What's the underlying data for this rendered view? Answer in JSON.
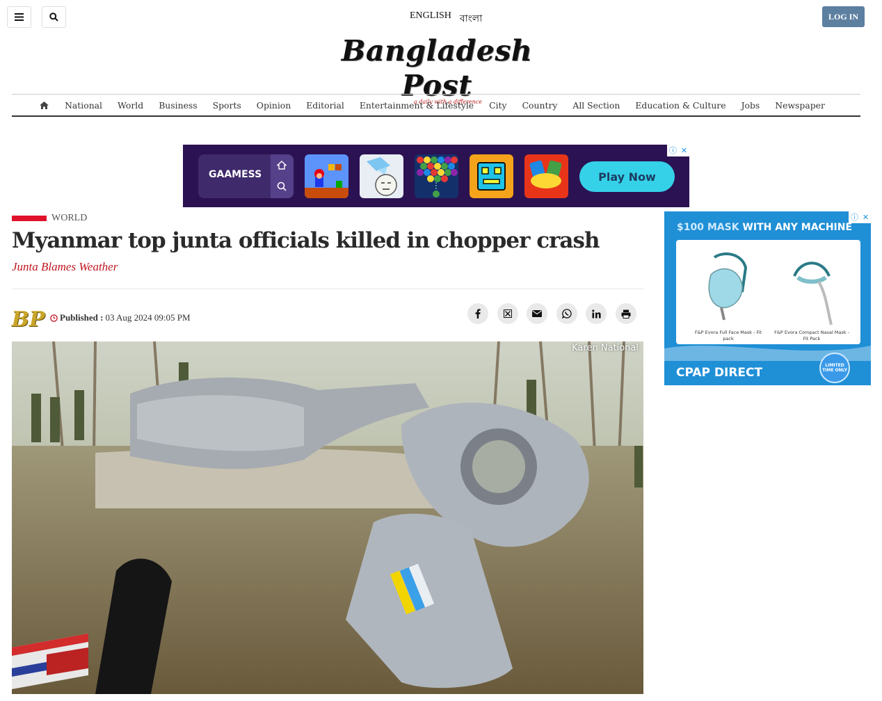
{
  "header": {
    "lang_english": "ENGLISH",
    "lang_bangla": "বাংলা",
    "login_label": "LOG IN",
    "logo_text": "Bangladesh Post",
    "logo_tagline": "a daily with a difference"
  },
  "nav": {
    "items": [
      "National",
      "World",
      "Business",
      "Sports",
      "Opinion",
      "Editorial",
      "Entertainment & Lifestyle",
      "City",
      "Country",
      "All Section",
      "Education & Culture",
      "Jobs",
      "Newspaper"
    ]
  },
  "ad_top": {
    "brand": "GAAMESS",
    "cta": "Play Now",
    "games": [
      "mario-game",
      "ice-face-game",
      "bubble-shooter-game",
      "geometry-dash-game",
      "uno-game"
    ]
  },
  "article": {
    "category": "WORLD",
    "title": "Myanmar top junta officials killed in chopper crash",
    "subtitle": "Junta Blames Weather",
    "published_label": "Published :",
    "published_date": "03 Aug 2024 09:05 PM",
    "author_logo": "BP",
    "image_credit": "Karen National"
  },
  "share_icons": [
    "facebook-icon",
    "x-icon",
    "email-icon",
    "whatsapp-icon",
    "linkedin-icon",
    "print-icon"
  ],
  "ad_side": {
    "headline_accent": "$100 MASK",
    "headline_rest": "WITH ANY MACHINE",
    "product1": "F&P Evora Full Face Mask - Fit pack",
    "product2": "F&P Evora Compact Nasal Mask - Fit Pack",
    "brand": "CPAP DIRECT",
    "badge": "LIMITED TIME ONLY"
  },
  "colors": {
    "accent_red": "#e0122b",
    "login_blue": "#5d7fa0",
    "ad_purple": "#2b1252",
    "ad_blue": "#1f8fd6"
  }
}
